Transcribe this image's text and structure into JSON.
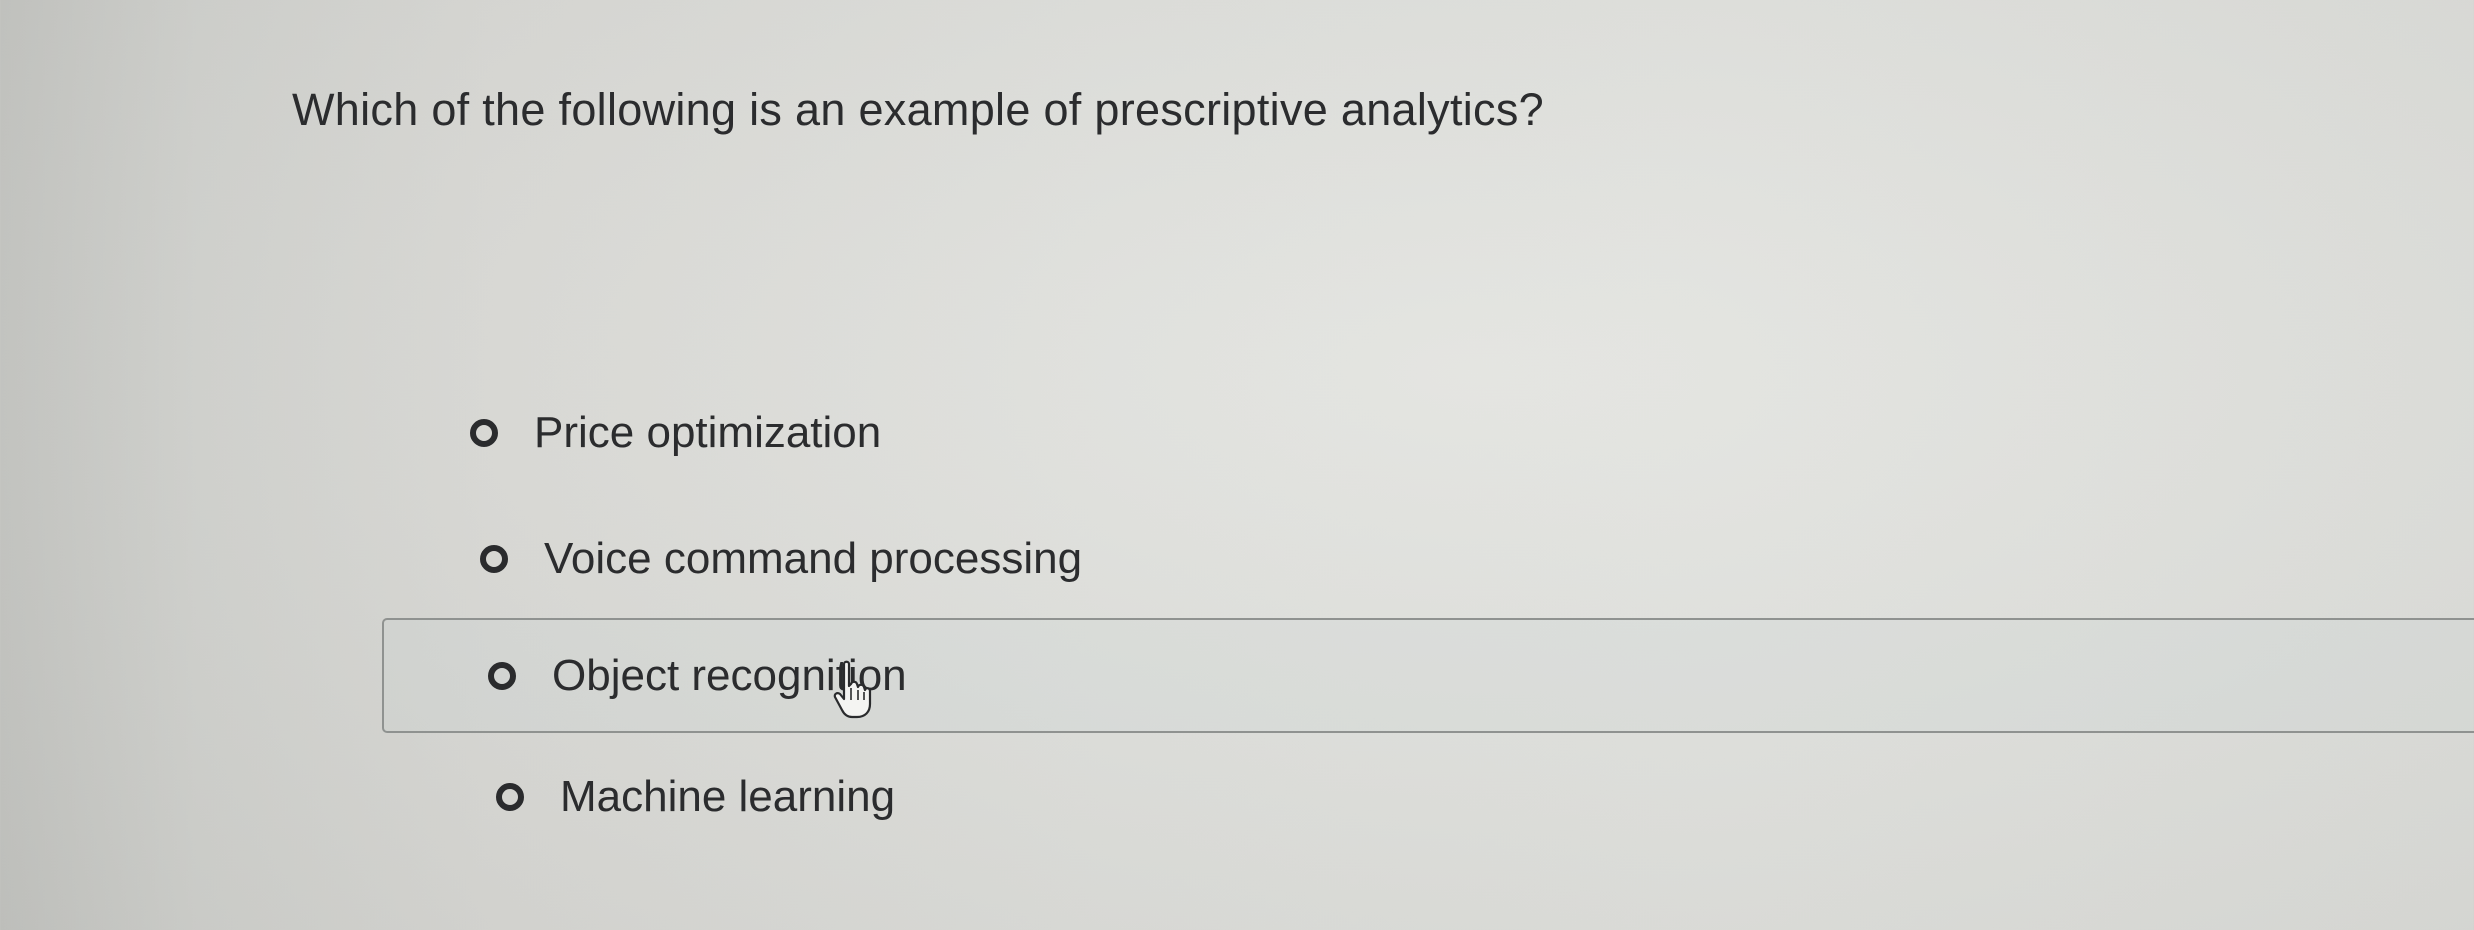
{
  "question": {
    "text": "Which of the following is an example of prescriptive analytics?"
  },
  "options": [
    {
      "label": "Price optimization",
      "selected": false
    },
    {
      "label": "Voice command processing",
      "selected": false
    },
    {
      "label": "Object recognition",
      "selected": false,
      "hovered": true
    },
    {
      "label": "Machine learning",
      "selected": false
    }
  ],
  "cursor": {
    "icon": "hand-pointer-icon"
  }
}
